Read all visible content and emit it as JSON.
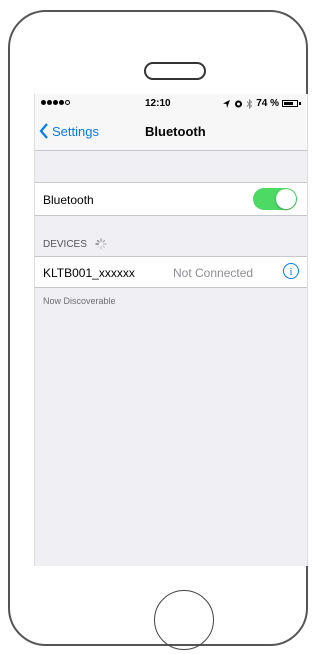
{
  "status_bar": {
    "time": "12:10",
    "battery_percent": "74 %",
    "battery_level": 0.74,
    "icons": [
      "signal-dots-icon",
      "location-icon",
      "alarm-icon",
      "bluetooth-icon",
      "battery-icon"
    ]
  },
  "nav": {
    "back_label": "Settings",
    "title": "Bluetooth"
  },
  "bluetooth_row": {
    "label": "Bluetooth",
    "enabled": true,
    "toggle_color": "#4cd964"
  },
  "devices": {
    "header": "DEVICES",
    "items": [
      {
        "name": "KLTB001_xxxxxx",
        "status": "Not Connected",
        "info_glyph": "i"
      }
    ]
  },
  "footer_text": "Now Discoverable",
  "colors": {
    "accent": "#007aff",
    "background": "#efeff4"
  }
}
